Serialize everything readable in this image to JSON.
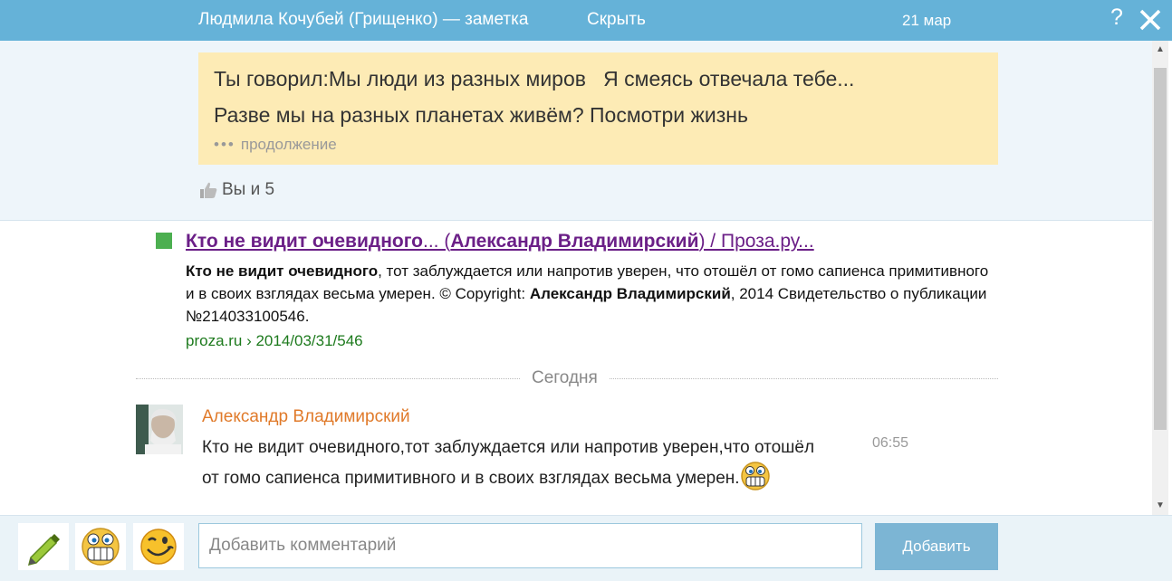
{
  "header": {
    "author": "Людмила Кочубей (Грищенко) — заметка",
    "hide_label": "Скрыть",
    "date": "21 мар",
    "help_label": "?"
  },
  "note": {
    "line1": "Ты говорил:Мы люди из разных миров   Я смеясь отвечала тебе...",
    "line2": "Разве мы на разных планетах живём? Посмотри жизнь",
    "more_dots": "•••",
    "more_label": "продолжение",
    "likes": "Вы и 5"
  },
  "result": {
    "title_b1": "Кто не видит очевидного",
    "title_t1": "... (",
    "title_b2": "Александр Владимирский",
    "title_t2": ") / Проза.ру...",
    "snippet_b1": "Кто не видит очевидного",
    "snippet_t1": ", тот заблуждается или напротив уверен, что отошёл от гомо сапиенса примитивного и в своих взглядах весьма умерен. © Copyright: ",
    "snippet_b2": "Александр Владимирский",
    "snippet_t2": ", 2014 Свидетельство о публикации №214033100546.",
    "url": "proza.ru › 2014/03/31/546"
  },
  "divider": {
    "label": "Сегодня"
  },
  "comment": {
    "author": "Александр Владимирский",
    "text": "Кто не видит очевидного,тот заблуждается или напротив уверен,что отошёл от гомо сапиенса примитивного и в своих взглядах весьма умерен.",
    "time": "06:55"
  },
  "footer": {
    "input_placeholder": "Добавить комментарий",
    "add_label": "Добавить"
  },
  "colors": {
    "header_bg": "#65b2d8",
    "note_bg": "#fdebb5",
    "link_visited": "#6b1f87",
    "url_green": "#1d7a1d",
    "author_orange": "#e07a2a",
    "add_button": "#7cb5d4"
  },
  "icons": [
    "thumbs-up-icon",
    "green-square-icon",
    "help-icon",
    "close-icon",
    "pencil-icon",
    "grin-smiley-icon",
    "wink-smiley-icon",
    "scroll-up-arrow-icon",
    "scroll-down-arrow-icon"
  ]
}
